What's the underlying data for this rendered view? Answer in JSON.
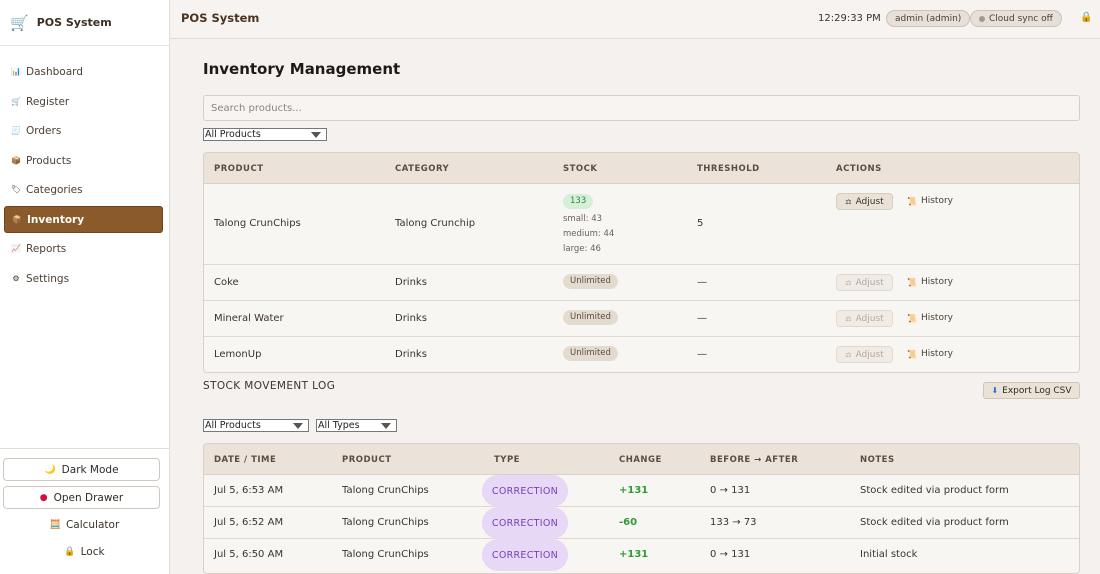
{
  "app": {
    "name": "POS System",
    "logo_icon": "cart-icon"
  },
  "sidebar": {
    "items": [
      {
        "label": "Dashboard",
        "icon": "chart-icon",
        "active": false
      },
      {
        "label": "Register",
        "icon": "cart-icon",
        "active": false
      },
      {
        "label": "Orders",
        "icon": "receipt-icon",
        "active": false
      },
      {
        "label": "Products",
        "icon": "box-icon",
        "active": false
      },
      {
        "label": "Categories",
        "icon": "tag-icon",
        "active": false
      },
      {
        "label": "Inventory",
        "icon": "box-icon",
        "active": true
      },
      {
        "label": "Reports",
        "icon": "chart-icon",
        "active": false
      },
      {
        "label": "Settings",
        "icon": "gear-icon",
        "active": false
      }
    ],
    "bottom": {
      "dark_mode": "Dark Mode",
      "open_drawer": "Open Drawer",
      "calculator": "Calculator",
      "lock": "Lock"
    }
  },
  "header": {
    "title": "POS System",
    "clock": "12:29:33 PM",
    "user": "admin (admin)",
    "sync": "Cloud sync off"
  },
  "main": {
    "title": "Inventory Management",
    "search_placeholder": "Search products...",
    "filter_product": "All Products",
    "inventory_table": {
      "headers": [
        "PRODUCT",
        "CATEGORY",
        "STOCK",
        "THRESHOLD",
        "ACTIONS"
      ],
      "rows": [
        {
          "product": "Talong CrunChips",
          "category": "Talong Crunchip",
          "stock": "133",
          "variants": [
            "small: 43",
            "medium: 44",
            "large: 46"
          ],
          "threshold": "5",
          "adjust": "Adjust",
          "history": "History",
          "adjust_enabled": true
        },
        {
          "product": "Coke",
          "category": "Drinks",
          "stock": "Unlimited",
          "threshold": "—",
          "adjust": "Adjust",
          "history": "History",
          "adjust_enabled": false
        },
        {
          "product": "Mineral Water",
          "category": "Drinks",
          "stock": "Unlimited",
          "threshold": "—",
          "adjust": "Adjust",
          "history": "History",
          "adjust_enabled": false
        },
        {
          "product": "LemonUp",
          "category": "Drinks",
          "stock": "Unlimited",
          "threshold": "—",
          "adjust": "Adjust",
          "history": "History",
          "adjust_enabled": false
        }
      ]
    },
    "log": {
      "title": "STOCK MOVEMENT LOG",
      "export": "Export Log CSV",
      "filter_product": "All Products",
      "filter_type": "All Types",
      "headers": [
        "DATE / TIME",
        "PRODUCT",
        "TYPE",
        "CHANGE",
        "BEFORE → AFTER",
        "NOTES"
      ],
      "rows": [
        {
          "date": "Jul 5, 6:53 AM",
          "product": "Talong CrunChips",
          "type": "CORRECTION",
          "change": "+131",
          "before_after": "0 → 131",
          "notes": "Stock edited via product form"
        },
        {
          "date": "Jul 5, 6:52 AM",
          "product": "Talong CrunChips",
          "type": "CORRECTION",
          "change": "-60",
          "before_after": "133 → 73",
          "notes": "Stock edited via product form"
        },
        {
          "date": "Jul 5, 6:50 AM",
          "product": "Talong CrunChips",
          "type": "CORRECTION",
          "change": "+131",
          "before_after": "0 → 131",
          "notes": "Initial stock"
        }
      ]
    }
  },
  "colors": {
    "accent": "#8a5a2b",
    "badge_green": "#2d8a3e",
    "type_purple": "#7a3cc4"
  }
}
